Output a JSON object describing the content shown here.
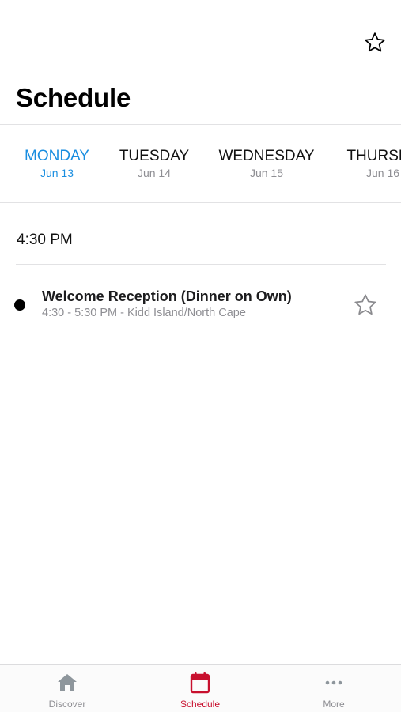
{
  "header": {
    "title": "Schedule",
    "favorites_icon": "star-outline-icon"
  },
  "days": [
    {
      "name": "MONDAY",
      "date": "Jun 13",
      "active": true
    },
    {
      "name": "TUESDAY",
      "date": "Jun 14",
      "active": false
    },
    {
      "name": "WEDNESDAY",
      "date": "Jun 15",
      "active": false
    },
    {
      "name": "THURSDAY",
      "date": "Jun 16",
      "active": false
    }
  ],
  "schedule": {
    "time_header": "4:30 PM",
    "sessions": [
      {
        "title": "Welcome Reception (Dinner on Own)",
        "subtitle": "4:30 - 5:30 PM - Kidd Island/North Cape",
        "icon": "star-outline-icon"
      }
    ]
  },
  "tab_bar": {
    "items": [
      {
        "label": "Discover",
        "icon": "home-icon",
        "active": false
      },
      {
        "label": "Schedule",
        "icon": "calendar-icon",
        "active": true
      },
      {
        "label": "More",
        "icon": "more-dots-icon",
        "active": false
      }
    ]
  },
  "colors": {
    "accent_blue": "#1a8ee0",
    "active_tab_red": "#c8102e",
    "secondary_text": "#8e8e93",
    "divider": "#e2e2e4"
  }
}
